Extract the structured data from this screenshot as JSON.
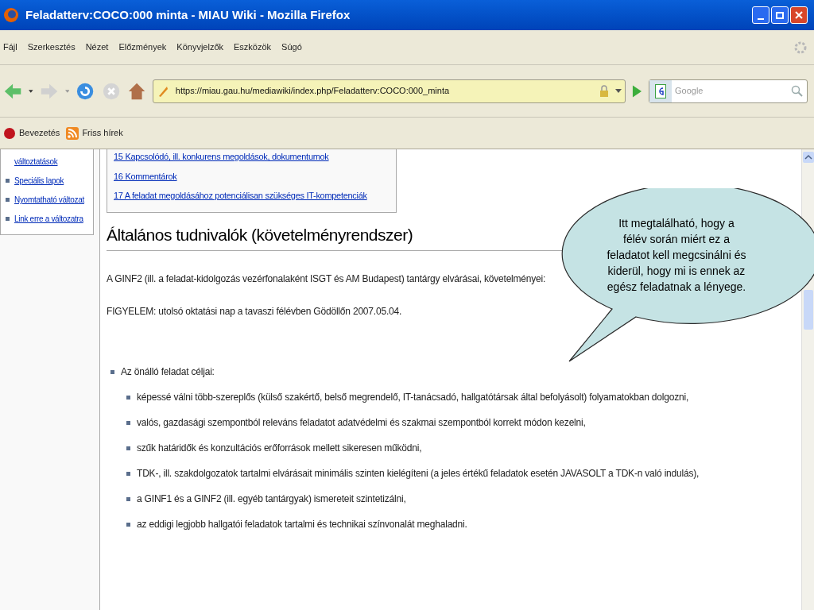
{
  "window": {
    "title": "Feladatterv:COCO:000 minta - MIAU Wiki - Mozilla Firefox"
  },
  "menu_bar": [
    "Fájl",
    "Szerkesztés",
    "Nézet",
    "Előzmények",
    "Könyvjelzők",
    "Eszközök",
    "Súgó"
  ],
  "toolbar": {
    "url": "https://miau.gau.hu/mediawiki/index.php/Feladatterv:COCO:000_minta",
    "search_placeholder": "Google"
  },
  "bookmarks": [
    {
      "label": "Bevezetés",
      "kind": "page"
    },
    {
      "label": "Friss hírek",
      "kind": "feed"
    }
  ],
  "sidebar": {
    "items": [
      {
        "label": "változtatások",
        "kind": "continuation"
      },
      {
        "label": "Speciális lapok",
        "kind": "link"
      },
      {
        "label": "Nyomtatható változat",
        "kind": "link"
      },
      {
        "label": "Link erre a változatra",
        "kind": "link"
      }
    ]
  },
  "toc": {
    "items": [
      "15 Kapcsolódó, ill. konkurens megoldások, dokumentumok",
      "16 Kommentárok",
      "17 A feladat megoldásához potenciálisan szükséges IT-kompetenciák"
    ]
  },
  "content": {
    "heading": "Általános tudnivalók (követelményrendszer)",
    "paragraphs": [
      "A GINF2 (ill. a feladat-kidolgozás vezérfonalaként ISGT és AM Budapest) tantárgy elvárásai, követelményei:",
      "FIGYELEM: utolsó oktatási nap a tavaszi félévben Gödöllőn 2007.05.04."
    ],
    "list": [
      {
        "label": "Az önálló feladat céljai:",
        "children": [
          {
            "label": "képessé válni több-szereplős (külső szakértő, belső megrendelő, IT-tanácsadó, hallgatótársak által befolyásolt) folyamatokban dolgozni,"
          },
          {
            "label": "valós, gazdasági szempontból releváns feladatot adatvédelmi és szakmai szempontból korrekt módon kezelni,"
          },
          {
            "label": "szűk határidők és konzultációs erőforrások mellett sikeresen működni,"
          },
          {
            "label": "TDK-, ill. szakdolgozatok tartalmi elvárásait minimális szinten kielégíteni (a jeles értékű feladatok esetén JAVASOLT a TDK-n való indulás),"
          },
          {
            "label": "a GINF1 és a GINF2 (ill. egyéb tantárgyak) ismereteit szintetizálni,"
          },
          {
            "label": "az eddigi legjobb hallgatói feladatok tartalmi és technikai színvonalát meghaladni."
          }
        ]
      }
    ]
  },
  "callout": {
    "text": "Itt megtalálható, hogy a félév során miért ez a feladatot kell megcsinálni és kiderül, hogy mi is ennek az egész feladatnak a lényege."
  }
}
